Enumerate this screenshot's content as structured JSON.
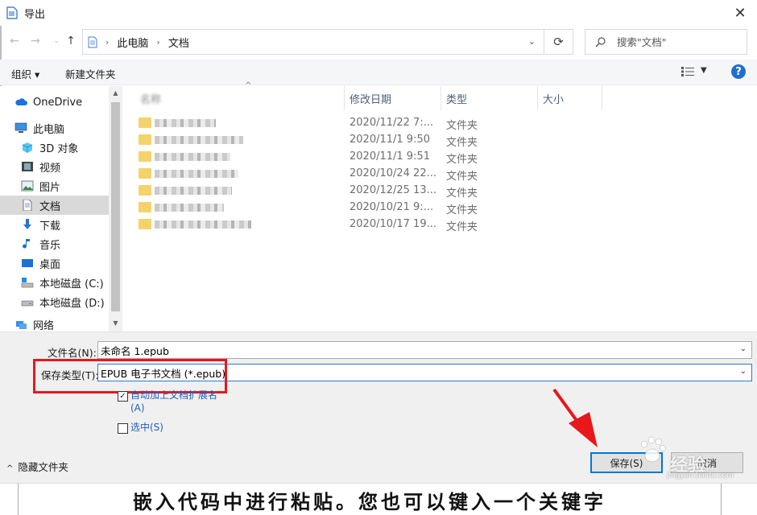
{
  "window": {
    "title": "导出"
  },
  "address": {
    "crumbs": [
      "此电脑",
      "文档"
    ]
  },
  "search": {
    "placeholder": "搜索\"文档\""
  },
  "toolbar": {
    "organize": "组织 ▾",
    "new_folder": "新建文件夹"
  },
  "sidebar": {
    "items": [
      {
        "label": "OneDrive",
        "icon": "cloud-icon"
      },
      {
        "label": "此电脑",
        "icon": "computer-icon"
      },
      {
        "label": "3D 对象",
        "icon": "cube-icon"
      },
      {
        "label": "视频",
        "icon": "video-icon"
      },
      {
        "label": "图片",
        "icon": "picture-icon"
      },
      {
        "label": "文档",
        "icon": "document-icon",
        "selected": true
      },
      {
        "label": "下载",
        "icon": "download-icon"
      },
      {
        "label": "音乐",
        "icon": "music-icon"
      },
      {
        "label": "桌面",
        "icon": "desktop-icon"
      },
      {
        "label": "本地磁盘 (C:)",
        "icon": "drive-c-icon"
      },
      {
        "label": "本地磁盘 (D:)",
        "icon": "drive-d-icon"
      },
      {
        "label": "网络",
        "icon": "network-icon"
      }
    ]
  },
  "columns": {
    "name": "名称",
    "modified": "修改日期",
    "type": "类型",
    "size": "大小"
  },
  "files": [
    {
      "modified": "2020/11/22 7:...",
      "type": "文件夹"
    },
    {
      "modified": "2020/11/1 9:50",
      "type": "文件夹"
    },
    {
      "modified": "2020/11/1 9:51",
      "type": "文件夹"
    },
    {
      "modified": "2020/10/24 22...",
      "type": "文件夹"
    },
    {
      "modified": "2020/12/25 13...",
      "type": "文件夹"
    },
    {
      "modified": "2020/10/21 9:...",
      "type": "文件夹"
    },
    {
      "modified": "2020/10/17 19...",
      "type": "文件夹"
    }
  ],
  "form": {
    "filename_label": "文件名(N):",
    "filename_value": "未命名 1.epub",
    "filetype_label": "保存类型(T):",
    "filetype_value": "EPUB 电子书文档 (*.epub)",
    "auto_ext_label": "自动加上文档扩展名\n(A)",
    "selection_label": "选中(S)",
    "hide_folders": "隐藏文件夹",
    "save": "保存(S)",
    "cancel": "取消"
  },
  "watermark": {
    "text": "经验",
    "url": "jingyan.baidu.com"
  },
  "caption": "嵌入代码中进行粘贴。您也可以键入一个关键字",
  "colors": {
    "highlight": "#e8171b",
    "accent": "#0078d7",
    "folder": "#f5d36b"
  }
}
